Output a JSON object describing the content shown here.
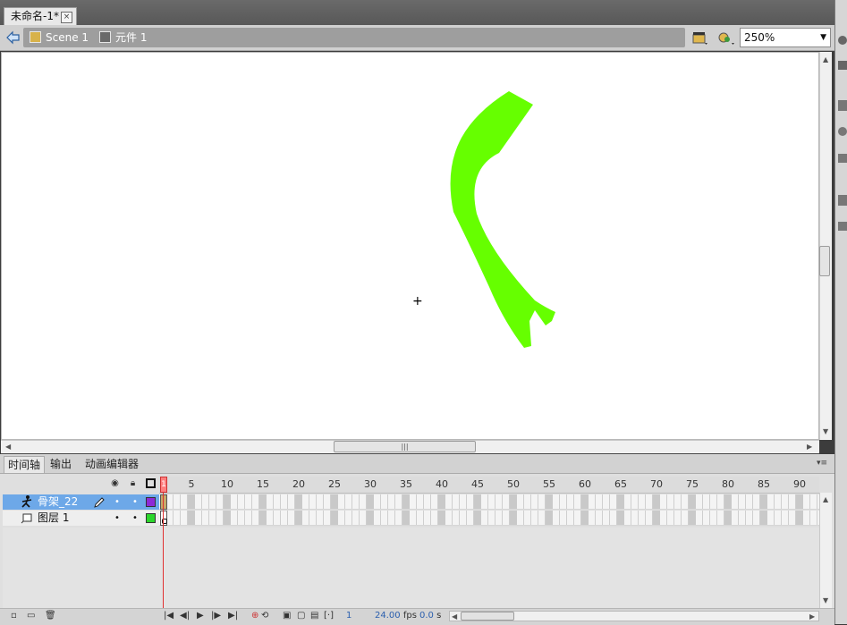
{
  "document": {
    "tab_title": "未命名-1*",
    "close_glyph": "×"
  },
  "editbar": {
    "back_icon": "back-arrow-icon",
    "scene_label": "Scene 1",
    "symbol_label": "元件 1",
    "zoom_value": "250%"
  },
  "colors": {
    "shape_fill": "#66ff00",
    "selected_layer": "#6da8e8",
    "armature_swatch": "#8e2ad6",
    "layer1_swatch": "#2cd62c",
    "playhead": "#ff5a5a"
  },
  "stage": {
    "registration_mark": "+"
  },
  "timeline": {
    "tabs": [
      "时间轴",
      "输出",
      "动画编辑器"
    ],
    "frame_numbers": [
      "1",
      "5",
      "10",
      "15",
      "20",
      "25",
      "30",
      "35",
      "40",
      "45",
      "50",
      "55",
      "60",
      "65",
      "70",
      "75",
      "80",
      "85",
      "90"
    ],
    "layers": [
      {
        "name": "骨架_22",
        "selected": true,
        "dot1": "•",
        "dot2": "•"
      },
      {
        "name": "图层 1",
        "selected": false,
        "dot1": "•",
        "dot2": "•"
      }
    ],
    "status": {
      "current_frame": "1",
      "fps": "24.00",
      "fps_unit": "fps",
      "time": "0.0",
      "time_unit": "s"
    }
  }
}
